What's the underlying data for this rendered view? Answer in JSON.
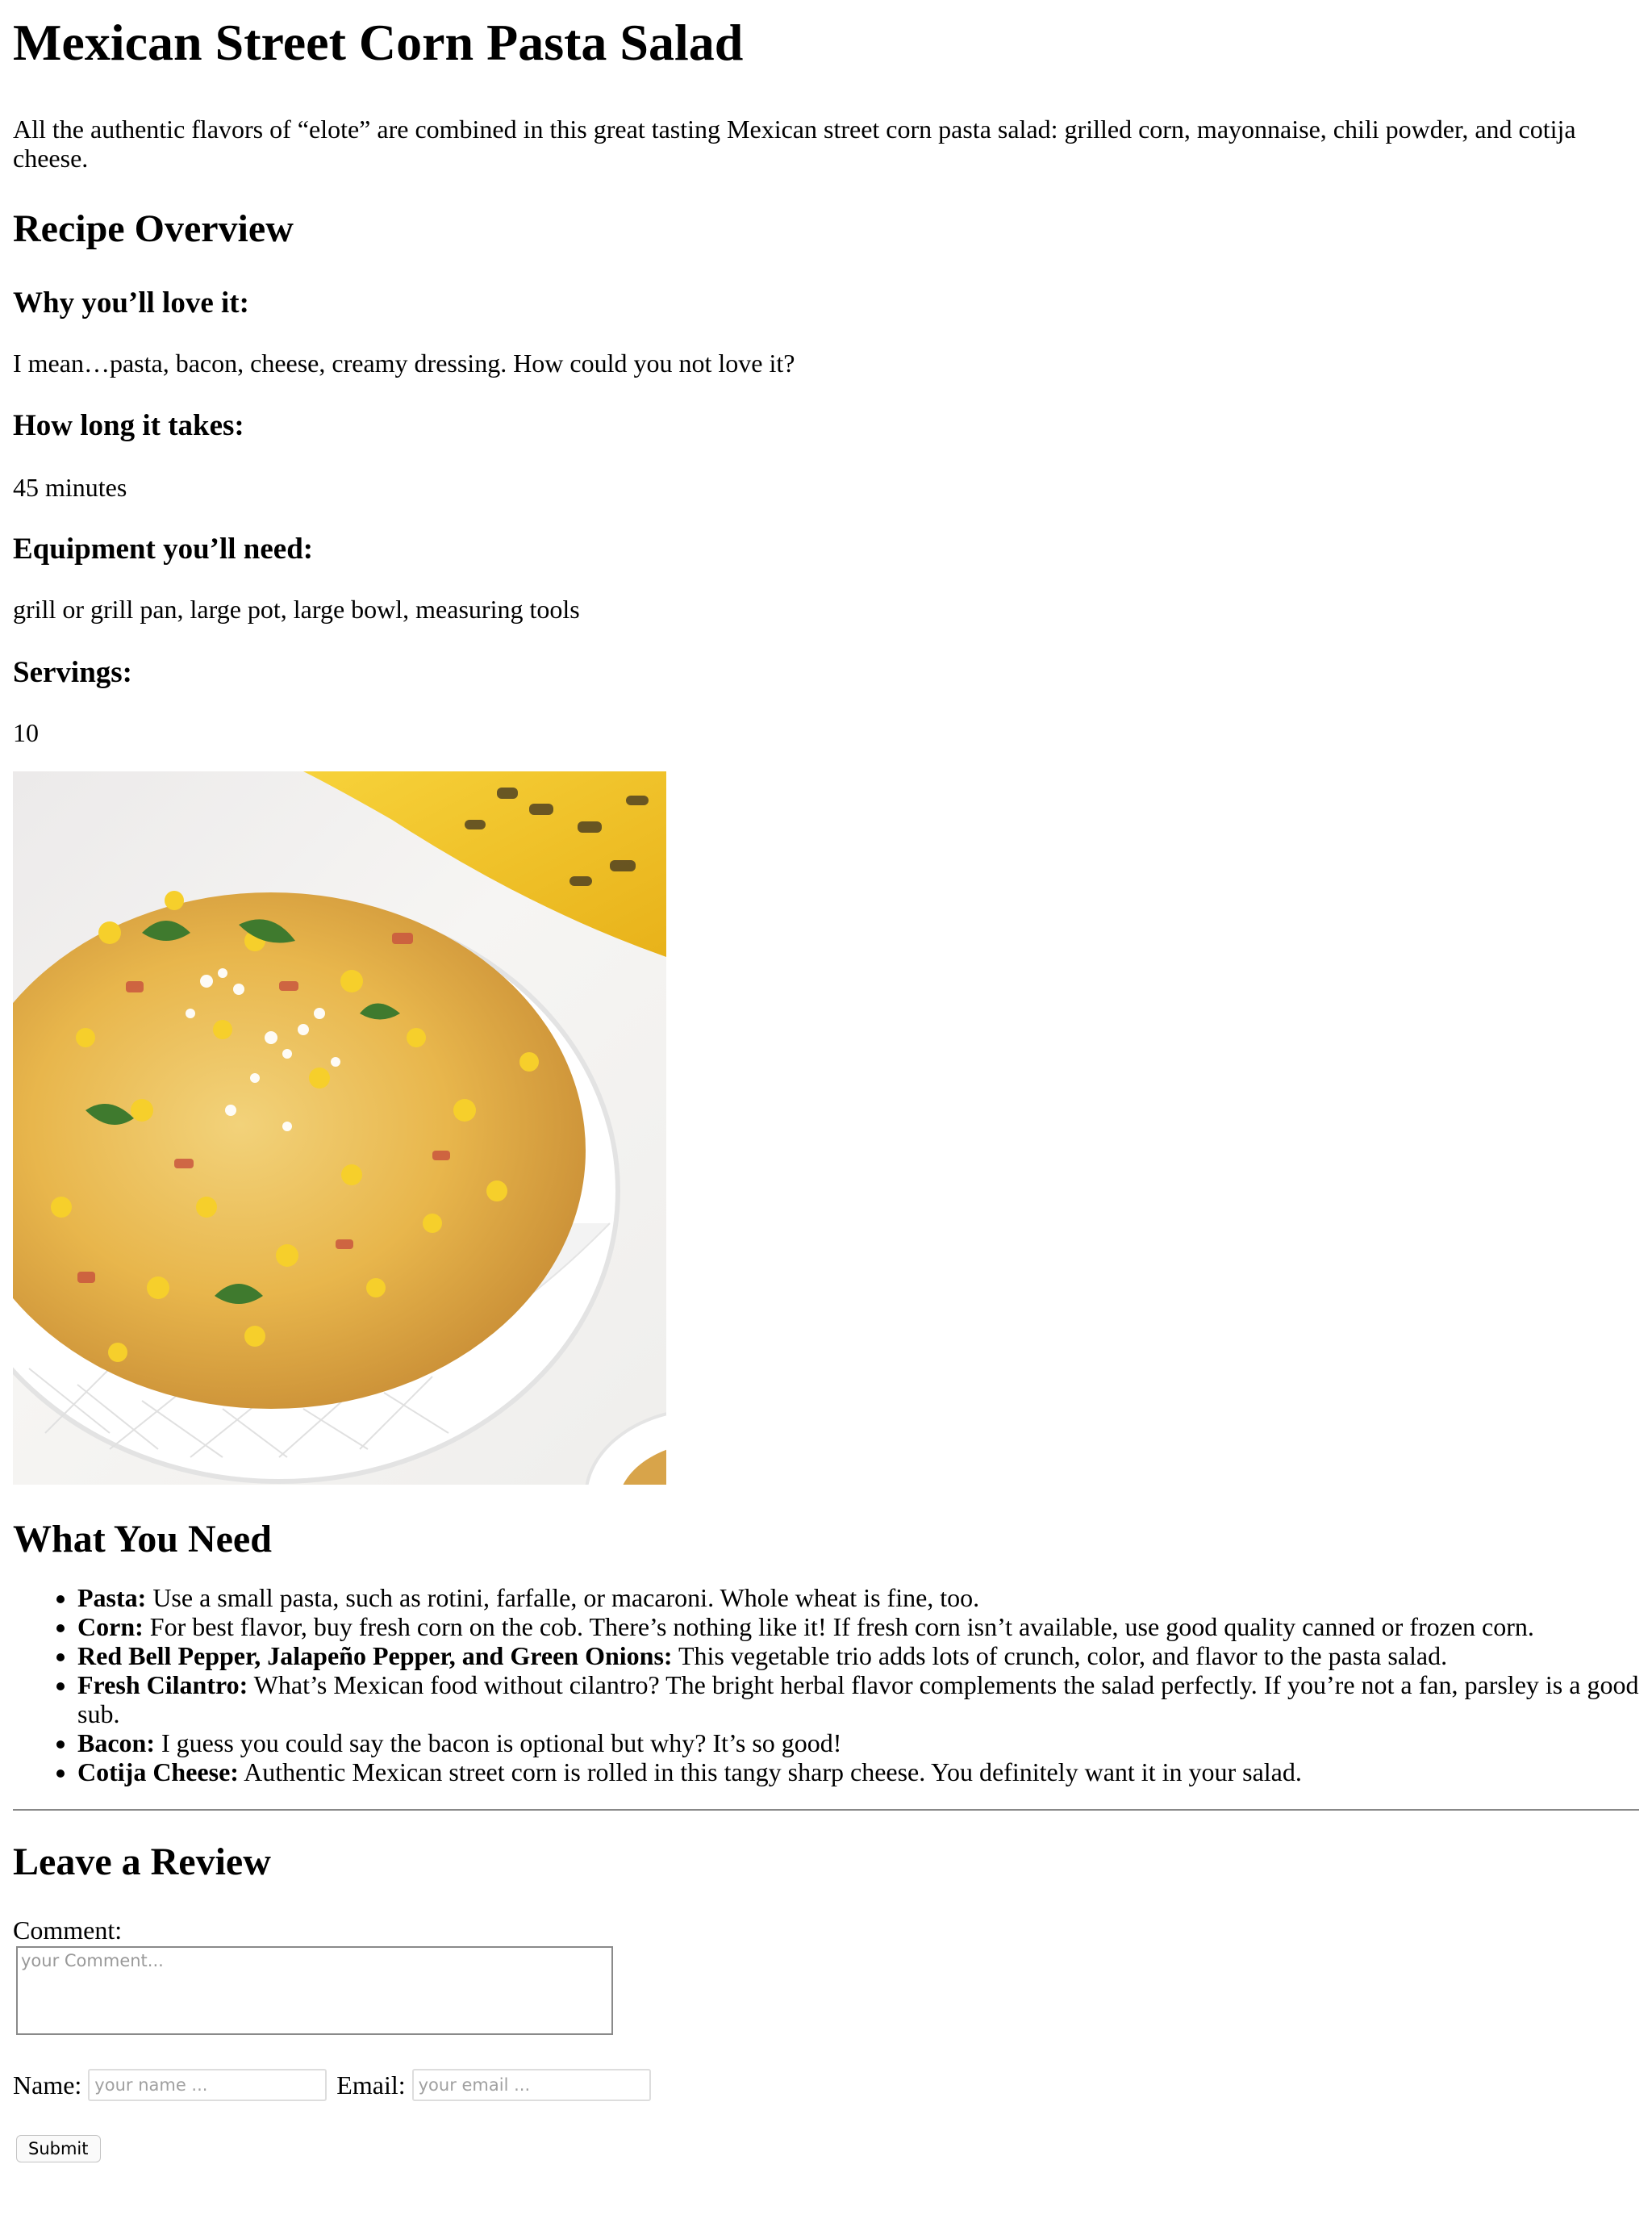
{
  "title": "Mexican Street Corn Pasta Salad",
  "intro": "All the authentic flavors of “elote” are combined in this great tasting Mexican street corn pasta salad: grilled corn, mayonnaise, chili powder, and cotija cheese.",
  "overview": {
    "heading": "Recipe Overview",
    "items": [
      {
        "label": "Why you’ll love it:",
        "value": "I mean…pasta, bacon, cheese, creamy dressing. How could you not love it?"
      },
      {
        "label": "How long it takes:",
        "value": "45 minutes"
      },
      {
        "label": "Equipment you’ll need:",
        "value": "grill or grill pan, large pot, large bowl, measuring tools"
      },
      {
        "label": "Servings:",
        "value": "10"
      }
    ]
  },
  "need": {
    "heading": "What You Need",
    "items": [
      {
        "term": "Pasta:",
        "text": " Use a small pasta, such as rotini, farfalle, or macaroni. Whole wheat is fine, too."
      },
      {
        "term": "Corn:",
        "text": " For best flavor, buy fresh corn on the cob. There’s nothing like it! If fresh corn isn’t available, use good quality canned or frozen corn."
      },
      {
        "term": "Red Bell Pepper, Jalapeño Pepper, and Green Onions:",
        "text": " This vegetable trio adds lots of crunch, color, and flavor to the pasta salad."
      },
      {
        "term": "Fresh Cilantro:",
        "text": " What’s Mexican food without cilantro? The bright herbal flavor complements the salad perfectly. If you’re not a fan, parsley is a good sub."
      },
      {
        "term": "Bacon:",
        "text": " I guess you could say the bacon is optional but why? It’s so good!"
      },
      {
        "term": "Cotija Cheese:",
        "text": " Authentic Mexican street corn is rolled in this tangy sharp cheese. You definitely want it in your salad."
      }
    ]
  },
  "review": {
    "heading": "Leave a Review",
    "comment_label": "Comment:",
    "comment_placeholder": "your Comment...",
    "name_label": "Name:",
    "name_placeholder": "your name ...",
    "email_label": "Email:",
    "email_placeholder": "your email ...",
    "submit_label": "Submit"
  }
}
